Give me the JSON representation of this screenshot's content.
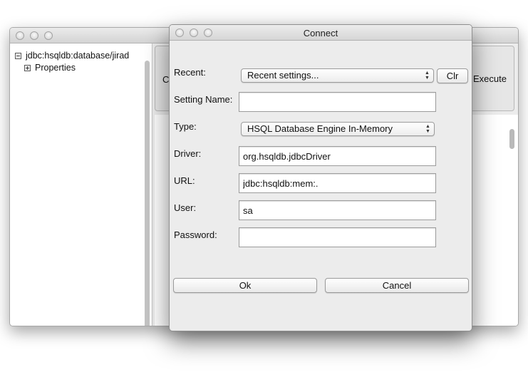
{
  "background_window": {
    "tree": {
      "root_label": "jdbc:hsqldb:database/jirad",
      "child_label": "Properties"
    },
    "toolbar": {
      "partial_label": "C",
      "execute_label": "Execute"
    }
  },
  "dialog": {
    "title": "Connect",
    "recent": {
      "label": "Recent:",
      "selected": "Recent settings...",
      "clear_label": "Clr"
    },
    "setting_name": {
      "label": "Setting Name:",
      "value": ""
    },
    "type": {
      "label": "Type:",
      "selected": "HSQL Database Engine In-Memory"
    },
    "driver": {
      "label": "Driver:",
      "value": "org.hsqldb.jdbcDriver"
    },
    "url": {
      "label": "URL:",
      "value": "jdbc:hsqldb:mem:."
    },
    "user": {
      "label": "User:",
      "value": "sa"
    },
    "password": {
      "label": "Password:",
      "value": ""
    },
    "ok_label": "Ok",
    "cancel_label": "Cancel"
  }
}
